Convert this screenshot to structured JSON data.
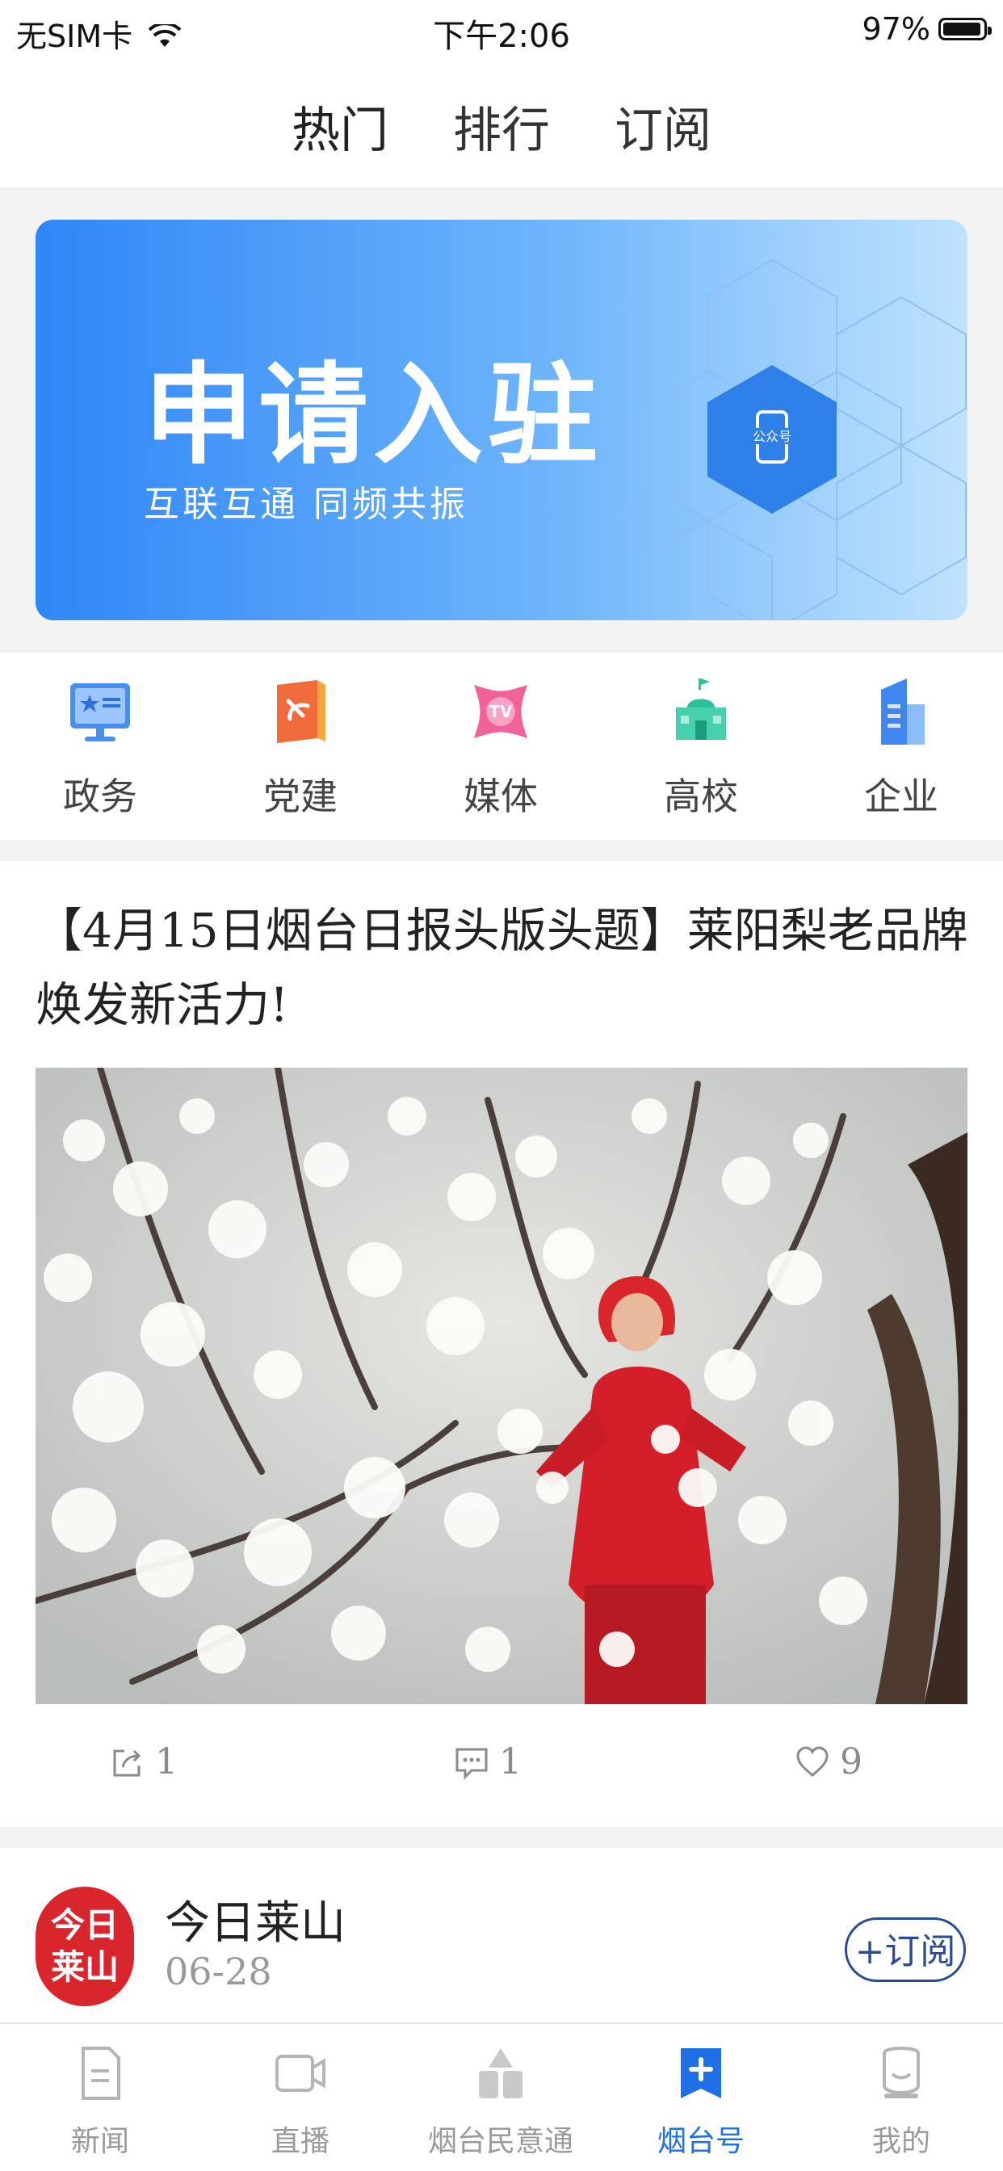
{
  "status_bar": {
    "carrier": "无SIM卡",
    "time": "下午2:06",
    "battery": "97%"
  },
  "top_tabs": [
    {
      "label": "热门"
    },
    {
      "label": "排行"
    },
    {
      "label": "订阅"
    }
  ],
  "banner": {
    "title": "申请入驻",
    "subtitle": "互联互通  同频共振",
    "badge": "公众号"
  },
  "categories": [
    {
      "label": "政务",
      "icon": "government-icon"
    },
    {
      "label": "党建",
      "icon": "party-building-icon"
    },
    {
      "label": "媒体",
      "icon": "media-tv-icon"
    },
    {
      "label": "高校",
      "icon": "university-icon"
    },
    {
      "label": "企业",
      "icon": "enterprise-icon"
    }
  ],
  "article": {
    "headline": "【4月15日烟台日报头版头题】莱阳梨老品牌焕发新活力!",
    "shares": "1",
    "comments": "1",
    "likes": "9"
  },
  "account": {
    "seal": "今日莱山",
    "name": "今日莱山",
    "date": "06-28",
    "subscribe_label": "+订阅"
  },
  "tab_bar": [
    {
      "label": "新闻",
      "icon": "news-icon"
    },
    {
      "label": "直播",
      "icon": "live-icon"
    },
    {
      "label": "烟台民意通",
      "icon": "public-opinion-icon"
    },
    {
      "label": "烟台号",
      "icon": "yantai-account-icon"
    },
    {
      "label": "我的",
      "icon": "profile-icon"
    }
  ],
  "colors": {
    "accent": "#1f6fe6",
    "banner_start": "#2f86f6",
    "banner_end": "#bfe2fd",
    "seal_red": "#d9262c",
    "subscribe_border": "#2a4b8f"
  }
}
